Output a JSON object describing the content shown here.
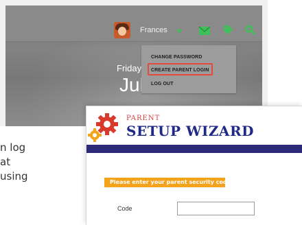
{
  "header": {
    "username": "Frances",
    "icons": [
      "mail-icon",
      "tag-icon",
      "search-icon"
    ]
  },
  "date": {
    "day": "Friday",
    "month": "Jul"
  },
  "dropdown": {
    "items": [
      {
        "label": "CHANGE PASSWORD"
      },
      {
        "label": "CREATE PARENT LOGIN"
      },
      {
        "label": "LOG OUT"
      }
    ]
  },
  "side_text": {
    "lines": [
      "n log",
      " at",
      "using"
    ]
  },
  "wizard": {
    "kicker": "PARENT",
    "title": "SETUP WIZARD",
    "prompt": "Please enter your parent security code:",
    "code_label": "Code",
    "code_value": ""
  },
  "colors": {
    "accent_green": "#3fc15a",
    "highlight_red": "#e24a3b",
    "wizard_blue": "#1f2a87",
    "prompt_orange": "#f3a21b"
  }
}
